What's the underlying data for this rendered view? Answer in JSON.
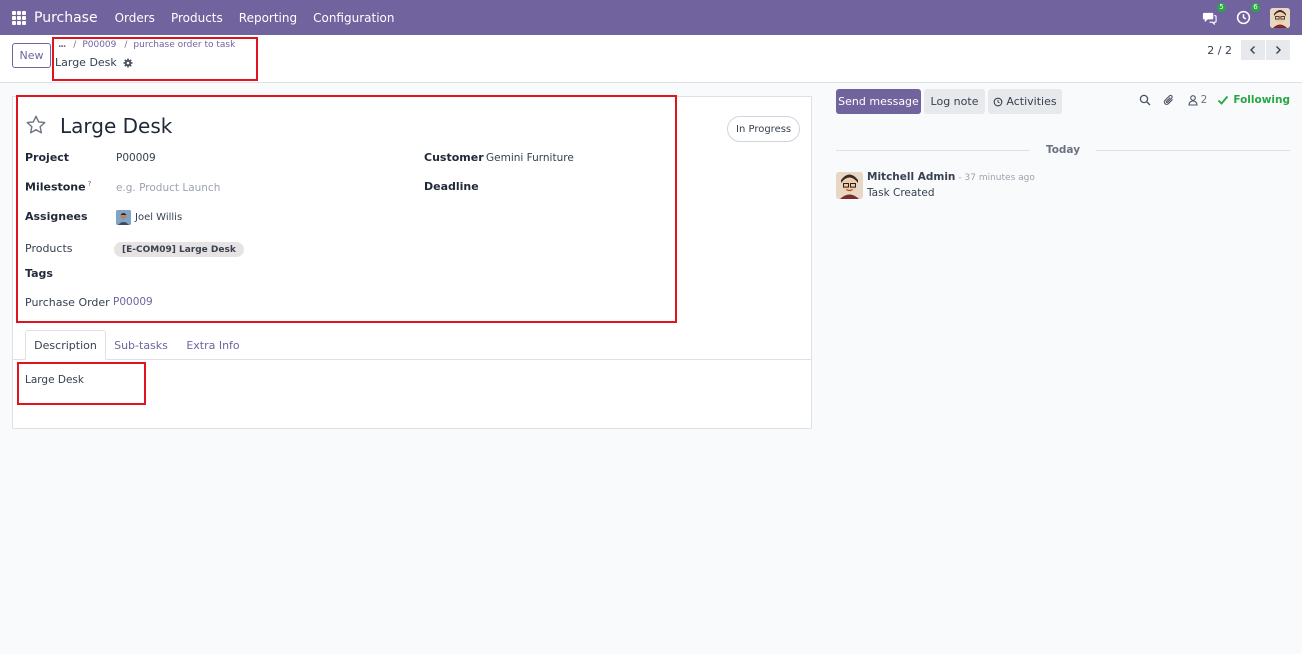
{
  "navbar": {
    "app_name": "Purchase",
    "menu": [
      "Orders",
      "Products",
      "Reporting",
      "Configuration"
    ],
    "messages_badge": "5",
    "activities_badge": "6",
    "color": "#71639e"
  },
  "control_panel": {
    "new_label": "New",
    "breadcrumb": [
      "...",
      "P00009",
      "purchase order to task"
    ],
    "record_title": "Large Desk",
    "pager": "2 / 2"
  },
  "form": {
    "task_name": "Large Desk",
    "stage": "In Progress",
    "fields": {
      "project_label": "Project",
      "project_value": "P00009",
      "customer_label": "Customer",
      "customer_value": "Gemini Furniture",
      "milestone_label": "Milestone",
      "milestone_help": "?",
      "milestone_placeholder": "e.g. Product Launch",
      "deadline_label": "Deadline",
      "assignees_label": "Assignees",
      "assignee_name": "Joel Willis",
      "products_label": "Products",
      "product_tag": "[E-COM09] Large Desk",
      "tags_label": "Tags",
      "purchase_order_label": "Purchase Order",
      "purchase_order_value": "P00009"
    },
    "tabs": [
      "Description",
      "Sub-tasks",
      "Extra Info"
    ],
    "active_tab": "Description",
    "description": "Large Desk"
  },
  "chatter": {
    "send_message": "Send message",
    "log_note": "Log note",
    "activities": "Activities",
    "followers_count": "2",
    "following_label": "Following",
    "date_separator": "Today",
    "messages": [
      {
        "author": "Mitchell Admin",
        "time": "- 37 minutes ago",
        "body": "Task Created"
      }
    ]
  },
  "highlight_color": "#e0141f"
}
